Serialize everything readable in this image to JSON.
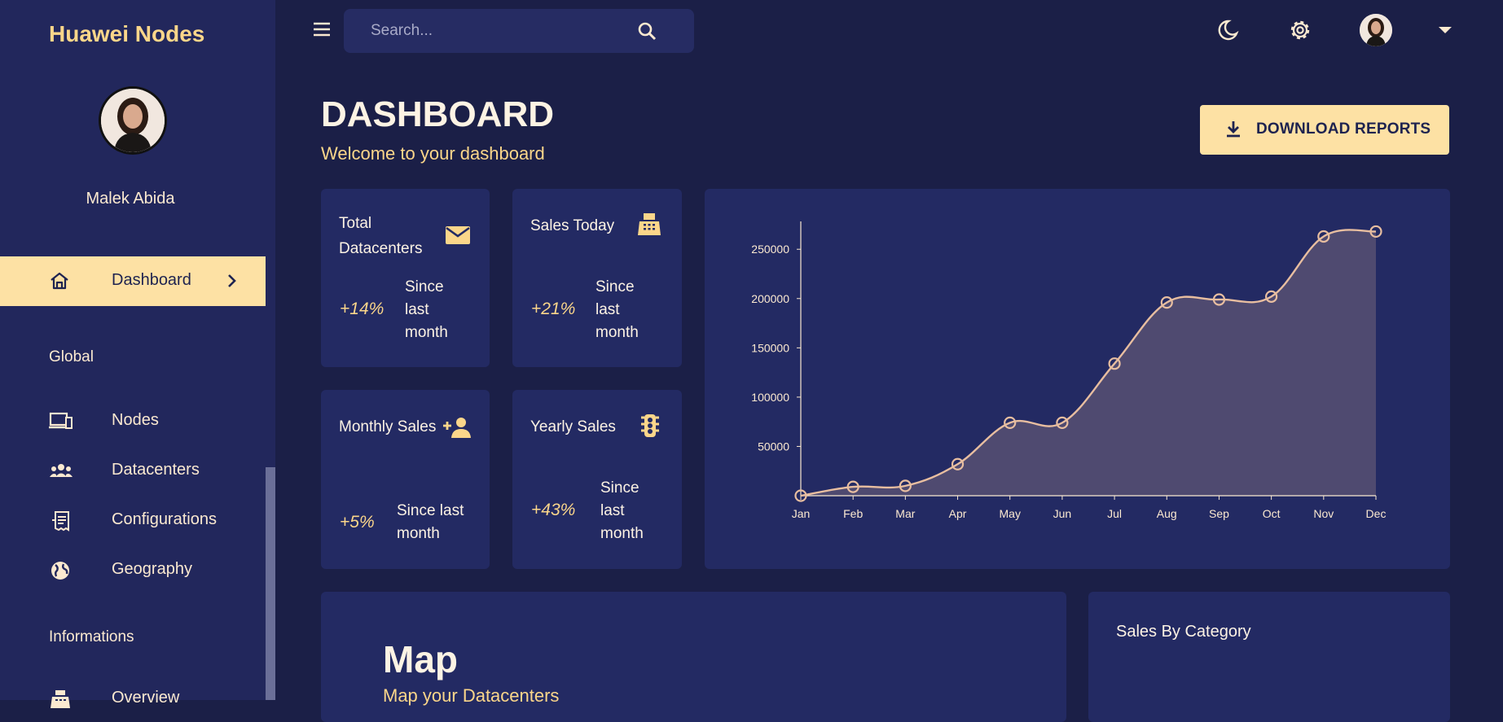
{
  "sidebar": {
    "brand": "Huawei Nodes",
    "user_name": "Malek Abida",
    "active_item": {
      "label": "Dashboard",
      "icon": "home-icon"
    },
    "sections": [
      {
        "title": "Global",
        "items": [
          {
            "label": "Nodes",
            "icon": "devices-icon"
          },
          {
            "label": "Datacenters",
            "icon": "groups-icon"
          },
          {
            "label": "Configurations",
            "icon": "receipt-icon"
          },
          {
            "label": "Geography",
            "icon": "globe-icon"
          }
        ]
      },
      {
        "title": "Informations",
        "items": [
          {
            "label": "Overview",
            "icon": "fax-icon"
          }
        ]
      }
    ]
  },
  "topbar": {
    "search_placeholder": "Search...",
    "icons": [
      "menu-icon",
      "search-icon",
      "moon-icon",
      "gear-icon",
      "avatar",
      "caret-down-icon"
    ]
  },
  "header": {
    "title": "DASHBOARD",
    "subtitle": "Welcome to your dashboard",
    "download_label": "DOWNLOAD REPORTS"
  },
  "stats": [
    {
      "title_line1": "Total",
      "title_line2": "Datacenters",
      "pct": "+14%",
      "since_l1": "Since",
      "since_l2": "last",
      "since_l3": "month",
      "icon": "mail-icon"
    },
    {
      "title_line1": "Sales Today",
      "title_line2": "",
      "pct": "+21%",
      "since_l1": "Since",
      "since_l2": "last",
      "since_l3": "month",
      "icon": "fax-icon"
    },
    {
      "title_line1": "Monthly Sales",
      "title_line2": "",
      "pct": "+5%",
      "since_l1": "Since last",
      "since_l2": "month",
      "since_l3": "",
      "icon": "person-add-icon"
    },
    {
      "title_line1": "Yearly Sales",
      "title_line2": "",
      "pct": "+43%",
      "since_l1": "Since",
      "since_l2": "last",
      "since_l3": "month",
      "icon": "traffic-light-icon"
    }
  ],
  "chart_data": {
    "type": "area",
    "categories": [
      "Jan",
      "Feb",
      "Mar",
      "Apr",
      "May",
      "Jun",
      "Jul",
      "Aug",
      "Sep",
      "Oct",
      "Nov",
      "Dec"
    ],
    "series": [
      {
        "values": [
          0,
          9000,
          10000,
          32000,
          74000,
          74000,
          134000,
          196000,
          199000,
          202000,
          263000,
          268000
        ]
      }
    ],
    "yticks": [
      50000,
      100000,
      150000,
      200000,
      250000
    ],
    "ylim": [
      0,
      270000
    ],
    "xlabel": "",
    "ylabel": "",
    "title": "",
    "line_color": "#e8bea0",
    "fill_color": "#4f4a70",
    "axis_color": "#fbe9d0",
    "grid": false
  },
  "map": {
    "title": "Map",
    "subtitle": "Map your Datacenters"
  },
  "category": {
    "title": "Sales By Category"
  }
}
